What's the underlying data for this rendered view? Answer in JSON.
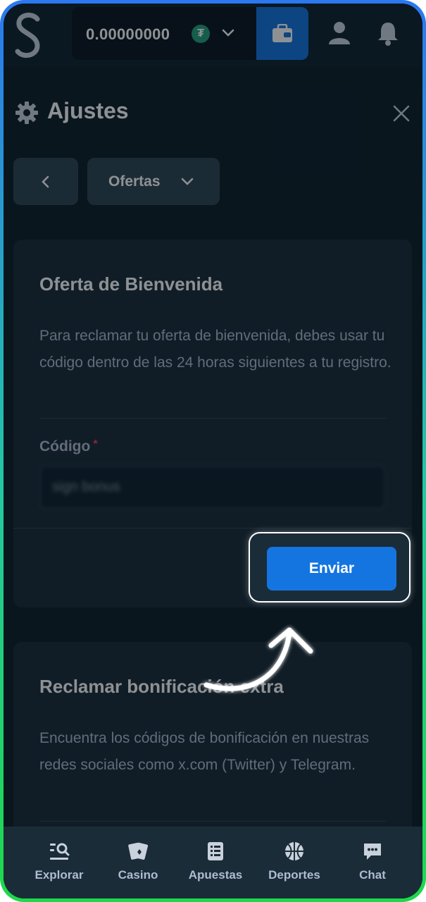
{
  "topbar": {
    "balance": "0.00000000",
    "currency_icon": "tether-icon",
    "accent": "#1475e1"
  },
  "header": {
    "title": "Ajustes"
  },
  "filter": {
    "selected": "Ofertas"
  },
  "welcome_offer": {
    "title": "Oferta de Bienvenida",
    "description": "Para reclamar tu oferta de bienvenida, debes usar tu código dentro de las 24 horas siguientes a tu registro.",
    "code_label": "Código",
    "required_mark": "*",
    "code_value": "sign bonus",
    "submit_label": "Enviar"
  },
  "extra_bonus": {
    "title": "Reclamar bonificación extra",
    "description": "Encuentra los códigos de bonificación en nuestras redes sociales como x.com (Twitter) y Telegram."
  },
  "bottom_nav": [
    {
      "label": "Explorar",
      "icon": "browse-icon"
    },
    {
      "label": "Casino",
      "icon": "casino-cards-icon"
    },
    {
      "label": "Apuestas",
      "icon": "bets-list-icon"
    },
    {
      "label": "Deportes",
      "icon": "basketball-icon"
    },
    {
      "label": "Chat",
      "icon": "chat-icon"
    }
  ]
}
